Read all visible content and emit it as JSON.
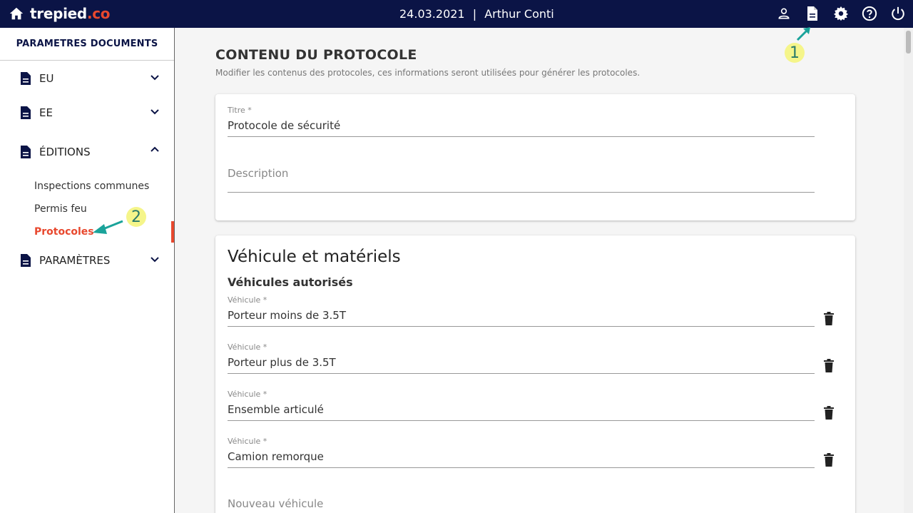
{
  "brand": {
    "name_main": "trepied",
    "name_tld": ".co"
  },
  "header": {
    "date": "24.03.2021",
    "separator": "|",
    "user": "Arthur Conti"
  },
  "sidebar": {
    "title": "PARAMETRES DOCUMENTS",
    "items": [
      {
        "label": "EU"
      },
      {
        "label": "EE"
      },
      {
        "label": "ÉDITIONS"
      },
      {
        "label": "PARAMÈTRES"
      }
    ],
    "subitems": [
      {
        "label": "Inspections communes"
      },
      {
        "label": "Permis feu"
      },
      {
        "label": "Protocoles"
      }
    ]
  },
  "main": {
    "title": "CONTENU DU PROTOCOLE",
    "subtitle": "Modifier les contenus des protocoles, ces informations seront utilisées pour générer les protocoles.",
    "card1": {
      "title_label": "Titre *",
      "title_value": "Protocole de sécurité",
      "description_placeholder": "Description"
    },
    "card2": {
      "heading": "Véhicule et matériels",
      "subheading": "Véhicules autorisés",
      "vehicles": [
        {
          "label": "Véhicule *",
          "value": "Porteur moins de 3.5T"
        },
        {
          "label": "Véhicule *",
          "value": "Porteur plus de 3.5T"
        },
        {
          "label": "Véhicule *",
          "value": "Ensemble articulé"
        },
        {
          "label": "Véhicule *",
          "value": "Camion remorque"
        }
      ],
      "new_vehicle_placeholder": "Nouveau véhicule"
    }
  },
  "annotations": {
    "badge1": "1",
    "badge2": "2"
  },
  "colors": {
    "topbar": "#0b1446",
    "accent": "#e8482e",
    "badge": "#f5f58a",
    "arrow": "#1aa39a"
  }
}
